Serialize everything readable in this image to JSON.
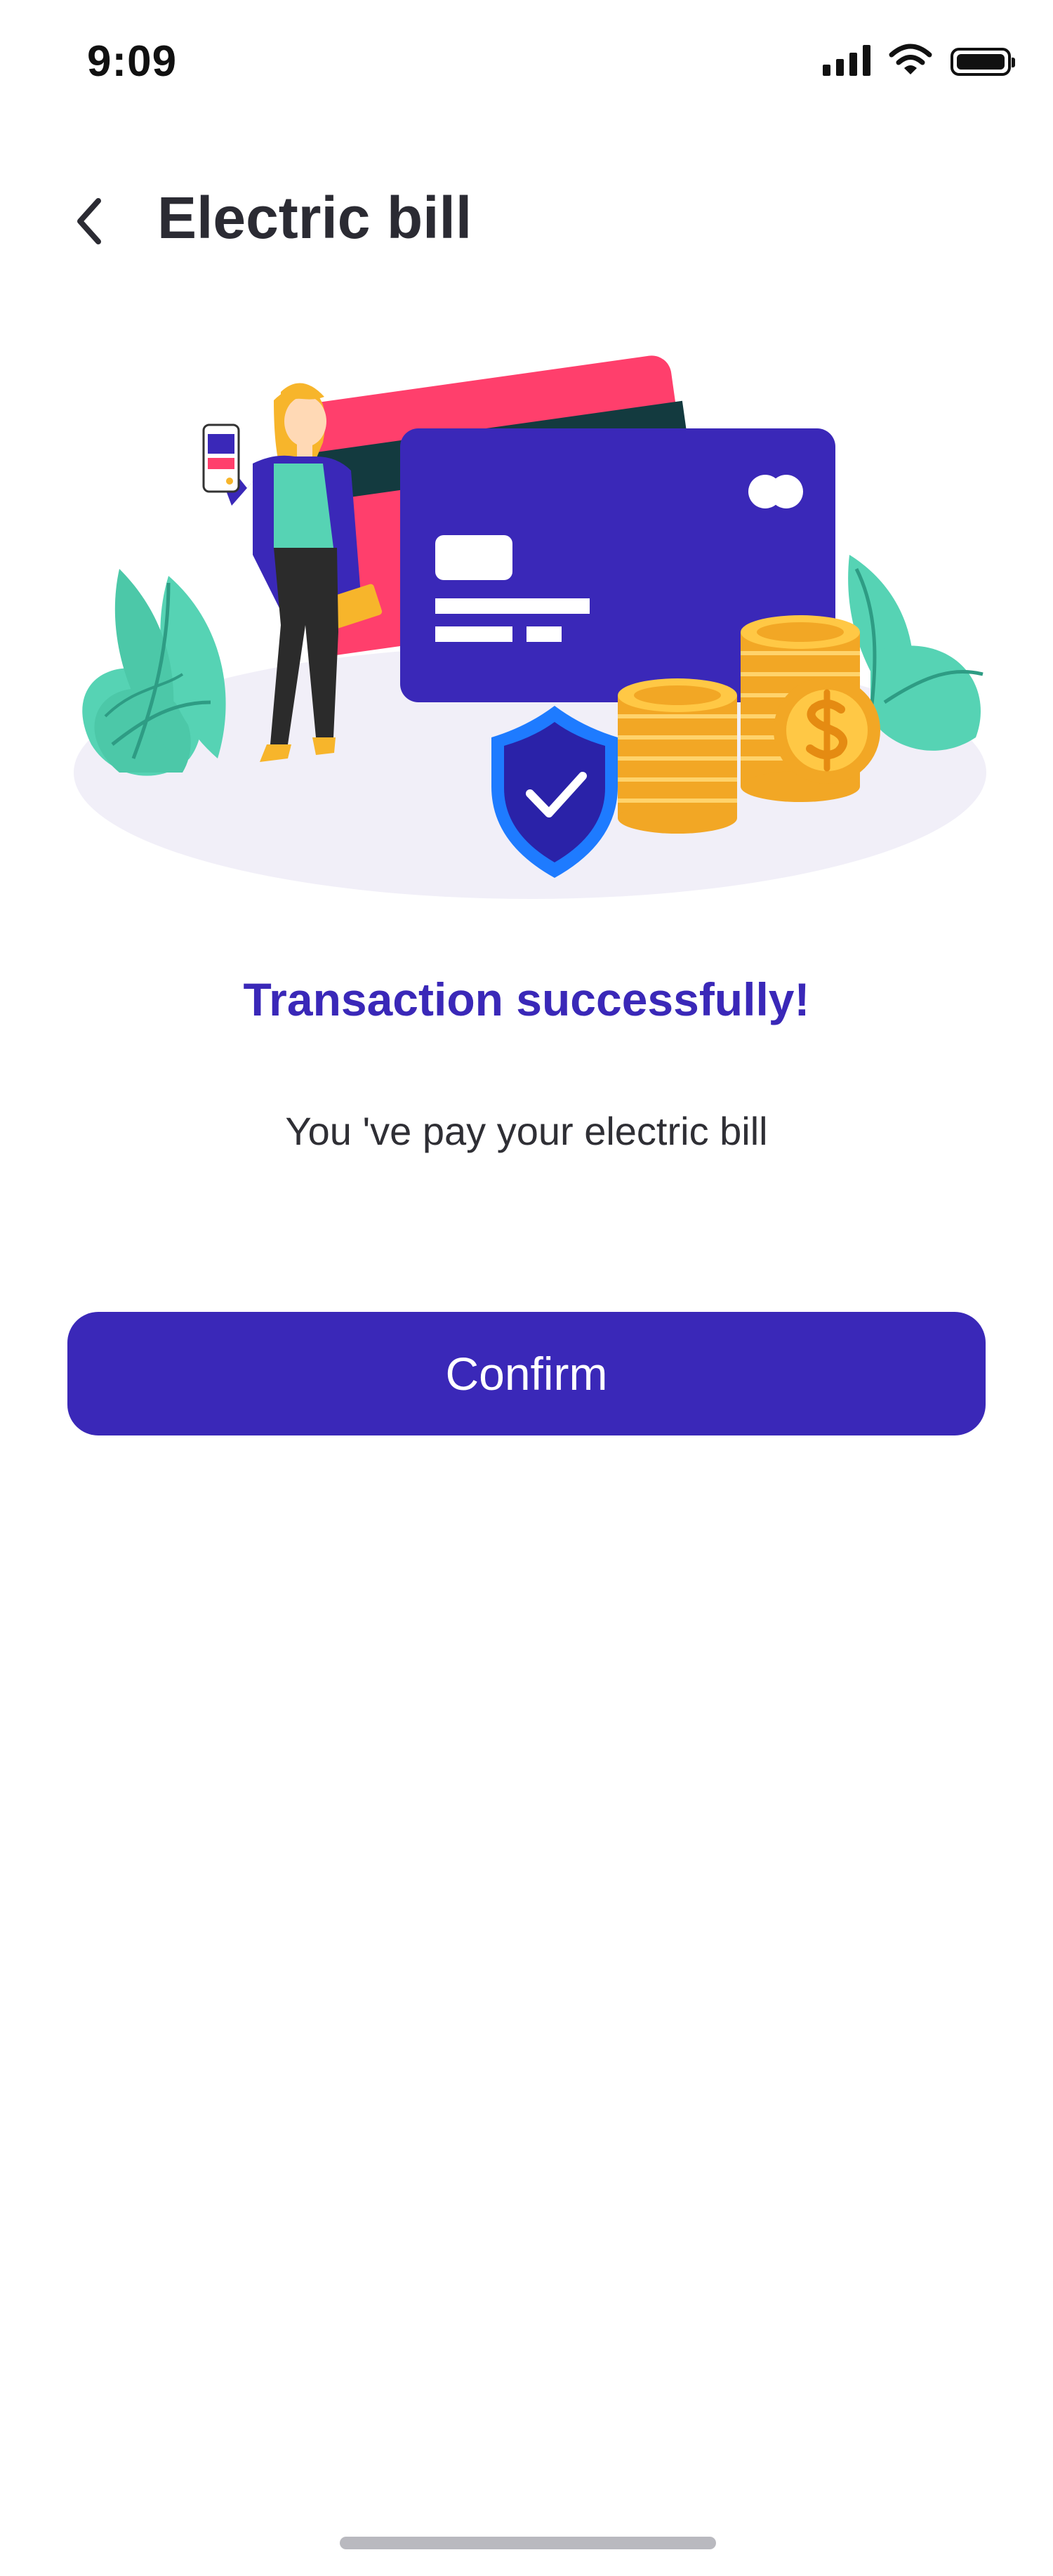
{
  "status_bar": {
    "time": "9:09",
    "icons": [
      "signal-icon",
      "wifi-icon",
      "battery-icon"
    ]
  },
  "header": {
    "title": "Electric bill",
    "back_icon": "chevron-left-icon"
  },
  "illustration": {
    "elements": [
      "woman-with-phone",
      "credit-cards",
      "shield-check-icon",
      "coin-stacks",
      "dollar-coin",
      "plants"
    ]
  },
  "message": {
    "title": "Transaction successfully!",
    "subtitle": "You 've pay your electric bill"
  },
  "actions": {
    "confirm_label": "Confirm"
  },
  "colors": {
    "primary": "#3a28b8",
    "card_pink": "#ff3f6c",
    "card_dark": "#133a3f",
    "leaf": "#56d3b4",
    "coin": "#f7b52b"
  }
}
